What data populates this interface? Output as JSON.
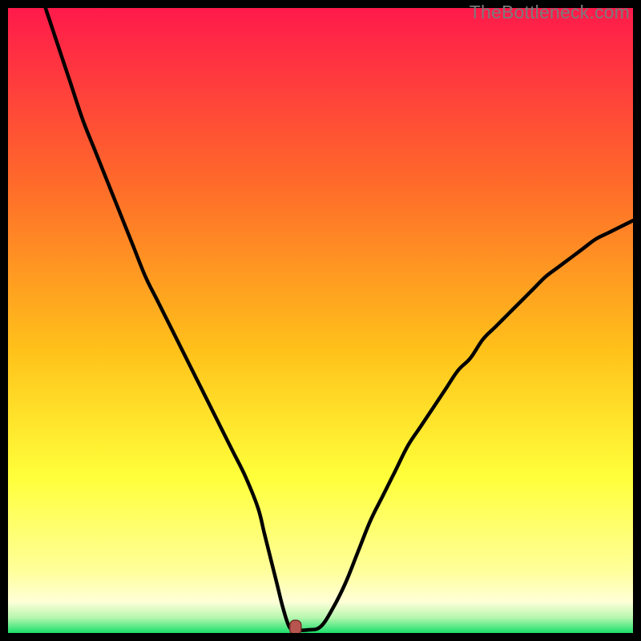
{
  "watermark": {
    "text": "TheBottleneck.com"
  },
  "colors": {
    "bg_black": "#000000",
    "grad_top": "#ff1a4b",
    "grad_mid1": "#ff7a2a",
    "grad_mid2": "#ffd21a",
    "grad_mid3": "#ffff55",
    "grad_low": "#ffffb0",
    "grad_green": "#1adf6b",
    "curve": "#000000",
    "marker_fill": "#b7564f",
    "marker_stroke": "#7a2f2a"
  },
  "chart_data": {
    "type": "line",
    "title": "",
    "xlabel": "",
    "ylabel": "",
    "xlim": [
      0,
      100
    ],
    "ylim": [
      0,
      100
    ],
    "series": [
      {
        "name": "bottleneck-curve",
        "x": [
          6,
          8,
          10,
          12,
          14,
          16,
          18,
          20,
          22,
          24,
          26,
          28,
          30,
          32,
          34,
          36,
          38,
          40,
          41,
          42,
          43,
          44,
          45,
          46,
          48,
          50,
          52,
          54,
          56,
          58,
          60,
          62,
          64,
          66,
          68,
          70,
          72,
          74,
          76,
          78,
          80,
          82,
          84,
          86,
          88,
          90,
          92,
          94,
          96,
          98,
          100
        ],
        "y": [
          100,
          94,
          88,
          82,
          77,
          72,
          67,
          62,
          57,
          53,
          49,
          45,
          41,
          37,
          33,
          29,
          25,
          20,
          16,
          12,
          8,
          4,
          1,
          0.5,
          0.5,
          1,
          4,
          8,
          13,
          18,
          22,
          26,
          30,
          33,
          36,
          39,
          42,
          44,
          47,
          49,
          51,
          53,
          55,
          57,
          58.5,
          60,
          61.5,
          63,
          64,
          65,
          66
        ]
      }
    ],
    "marker": {
      "x": 46,
      "y": 0.5
    }
  }
}
